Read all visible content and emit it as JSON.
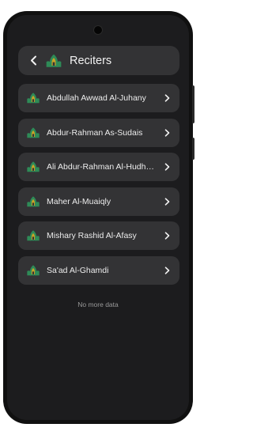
{
  "header": {
    "title": "Reciters"
  },
  "reciters": [
    {
      "name": "Abdullah Awwad Al-Juhany"
    },
    {
      "name": "Abdur-Rahman As-Sudais"
    },
    {
      "name": "Ali Abdur-Rahman Al-Hudhaify"
    },
    {
      "name": "Maher Al-Muaiqly"
    },
    {
      "name": "Mishary Rashid Al-Afasy"
    },
    {
      "name": "Sa'ad Al-Ghamdi"
    }
  ],
  "footer": {
    "no_more": "No more data"
  },
  "icons": {
    "back": "chevron-left-icon",
    "logo": "mosque-logo-icon",
    "row_arrow": "chevron-right-icon"
  },
  "colors": {
    "screen_bg": "#1c1c1e",
    "card_bg": "#333335",
    "logo_green": "#2e8b57",
    "logo_gold": "#c9a227"
  }
}
